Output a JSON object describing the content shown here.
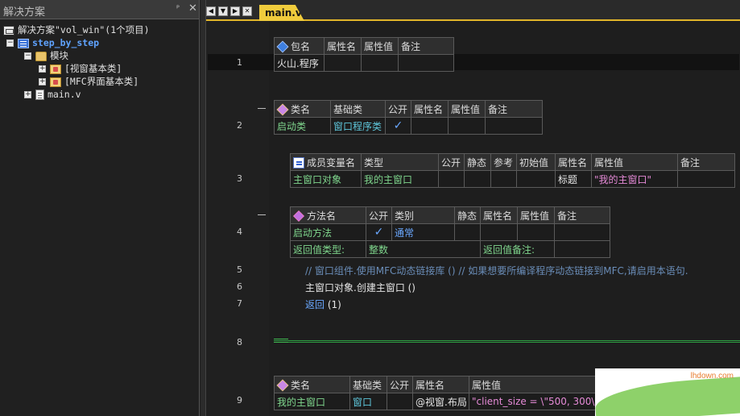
{
  "solution_panel": {
    "title": "解决方案",
    "pin": "ᴾ",
    "close": "✕",
    "tree": [
      {
        "label": "解决方案\"vol_win\"(1个项目)"
      },
      {
        "label": "step_by_step"
      },
      {
        "label": "模块"
      },
      {
        "label": "[视窗基本类]"
      },
      {
        "label": "[MFC界面基本类]"
      },
      {
        "label": "main.v"
      }
    ]
  },
  "editor": {
    "tab": "main.v",
    "nav": [
      "◀",
      "▼",
      "▶",
      "✕"
    ],
    "line_numbers": [
      "1",
      "2",
      "3",
      "4",
      "5",
      "6",
      "7",
      "8",
      "9"
    ],
    "package_table": {
      "headers": [
        "包名",
        "属性名",
        "属性值",
        "备注"
      ],
      "row": [
        "火山.程序",
        "",
        "",
        ""
      ]
    },
    "class_table": {
      "headers": [
        "类名",
        "基础类",
        "公开",
        "属性名",
        "属性值",
        "备注"
      ],
      "row": [
        "启动类",
        "窗口程序类",
        "✓",
        "",
        "",
        ""
      ]
    },
    "member_table": {
      "headers": [
        "成员变量名",
        "类型",
        "公开",
        "静态",
        "参考",
        "初始值",
        "属性名",
        "属性值",
        "备注"
      ],
      "row": [
        "主窗口对象",
        "我的主窗口",
        "",
        "",
        "",
        "",
        "标题",
        "\"我的主窗口\"",
        ""
      ]
    },
    "method_table": {
      "headers": [
        "方法名",
        "公开",
        "类别",
        "静态",
        "属性名",
        "属性值",
        "备注"
      ],
      "row": [
        "启动方法",
        "✓",
        "通常",
        "",
        "",
        "",
        ""
      ],
      "return_type_label": "返回值类型:",
      "return_type_value": "整数",
      "return_note_label": "返回值备注:"
    },
    "code_lines": {
      "line5": "// 窗口组件.使用MFC动态链接库 ()  // 如果想要所编译程序动态链接到MFC,请启用本语句.",
      "line6": "主窗口对象.创建主窗口 ()",
      "line7_keyword": "返回",
      "line7_arg": "(1)"
    },
    "class_table2": {
      "headers": [
        "类名",
        "基础类",
        "公开",
        "属性名",
        "属性值"
      ],
      "row": [
        "我的主窗口",
        "窗口",
        "",
        "@视窗.布局",
        "\"client_size = \\\"500, 300\\\""
      ]
    }
  },
  "watermark": {
    "text": "lhdown.com"
  },
  "colors": {
    "accent": "#f0cc3c",
    "string": "#e58ad7",
    "keyword": "#6aa8ff",
    "identifier": "#7fd68d"
  }
}
